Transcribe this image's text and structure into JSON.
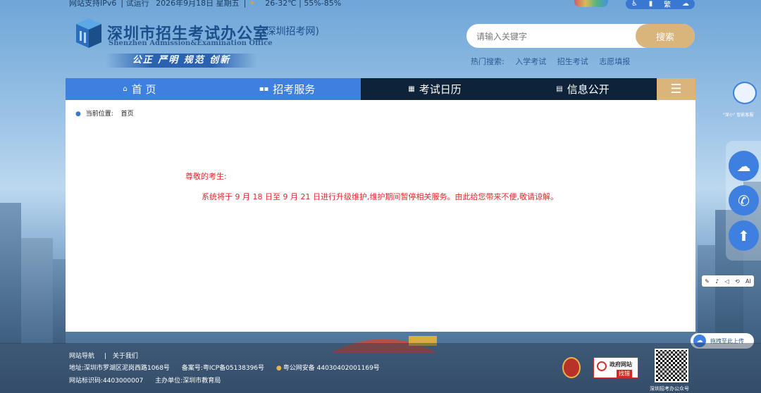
{
  "topbar": {
    "ipv6": "网站支持IPv6",
    "trial": "试运行",
    "date": "2026年9月18日 星期五",
    "weather": "26-32℃ | 55%-85%"
  },
  "top_right": {
    "accessibility": "♿",
    "bars": "▮",
    "traditional": "繁",
    "wechat": "☁"
  },
  "logo": {
    "title_cn": "深圳市招生考试办公室",
    "subtitle": "(深圳招考网)",
    "title_en": "Shenzhen Admission&Examination Office",
    "slogan": "公正 严明 规范 创新"
  },
  "search": {
    "placeholder": "请输入关键字",
    "button": "搜索"
  },
  "hot_search": {
    "label": "热门搜索:",
    "items": [
      "入学考试",
      "招生考试",
      "志愿填报"
    ]
  },
  "nav": {
    "items": [
      {
        "icon": "⌂",
        "label": "首 页"
      },
      {
        "icon": "▪▪",
        "label": "招考服务"
      },
      {
        "icon": "▦",
        "label": "考试日历"
      },
      {
        "icon": "▤",
        "label": "信息公开"
      }
    ],
    "menu": "☰"
  },
  "breadcrumb": {
    "label": "当前位置:",
    "current": "首页"
  },
  "notice": {
    "greeting": "尊敬的考生:",
    "body": "系统将于 9 月 18 日至 9 月 21 日进行升级维护,维护期间暂停相关服务。由此给您带来不便,敬请谅解。"
  },
  "float": {
    "robot_label": "\"深小\" 智能客服",
    "wechat": "☁",
    "phone": "✆",
    "top": "⬆"
  },
  "tools": {
    "items": [
      "✎",
      "♪",
      "◁",
      "⟲",
      "AI"
    ]
  },
  "upload": {
    "label": "拖拽至此上传"
  },
  "footer": {
    "nav": "网站导航",
    "about": "关于我们",
    "address": "地址:深圳市罗湖区泥岗西路1068号",
    "icp": "备案号:粤ICP备05138396号",
    "police": "粤公网安备 44030402001169号",
    "site_code": "网站标识码:4403000007",
    "host": "主办单位:深圳市教育局",
    "gov_badge_title": "政府网站",
    "gov_badge_action": "找错",
    "qr_label": "深圳招考办公众号"
  }
}
